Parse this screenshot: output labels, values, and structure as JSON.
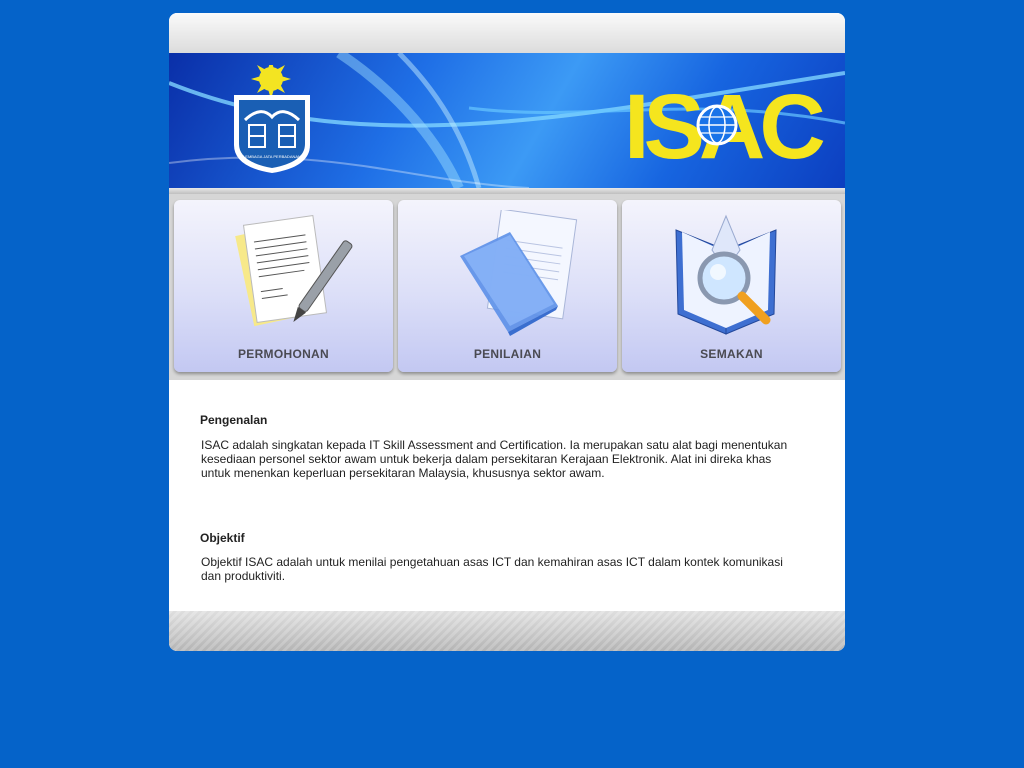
{
  "colors": {
    "background": "#0563c9",
    "banner_blue": "#1f6fe6",
    "logo_yellow": "#f5e51e",
    "tile_gradient_bottom": "#c3c8f2"
  },
  "header": {
    "emblem_icon": "jata-emblem-icon",
    "emblem_caption": "LEMBAGA JATA PERBADANAN",
    "logo_text": "ISAC"
  },
  "menu": [
    {
      "label": "PERMOHONAN",
      "icon": "document-pen-icon"
    },
    {
      "label": "PENILAIAN",
      "icon": "document-stack-icon"
    },
    {
      "label": "SEMAKAN",
      "icon": "book-magnifier-icon"
    }
  ],
  "sections": {
    "intro": {
      "title": "Pengenalan",
      "line1": "ISAC adalah singkatan kepada IT Skill Assessment and Certification. Ia merupakan satu alat bagi menentukan",
      "line2": "kesediaan personel sektor awam untuk bekerja dalam persekitaran Kerajaan Elektronik.  Alat ini direka khas",
      "line3": "untuk menenkan keperluan persekitaran Malaysia, khususnya sektor awam."
    },
    "objective": {
      "title": "Objektif",
      "line1": "Objektif ISAC adalah untuk menilai pengetahuan asas ICT dan kemahiran asas ICT dalam kontek komunikasi",
      "line2": "dan produktiviti."
    }
  }
}
